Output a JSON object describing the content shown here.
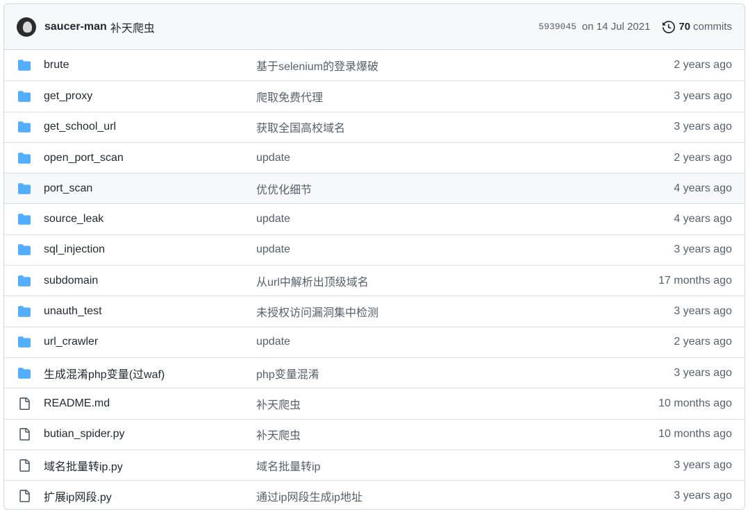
{
  "latest_commit": {
    "author": "saucer-man",
    "message": "补天爬虫",
    "sha": "5939045",
    "date": "on 14 Jul 2021",
    "commits_count": "70",
    "commits_label": "commits"
  },
  "colors": {
    "folder": "#54aeff",
    "file_icon": "#57606a",
    "border": "#d0d7de",
    "header_bg": "#f6f8fa"
  },
  "files": [
    {
      "type": "folder",
      "icon": "folder-icon",
      "name": "brute",
      "message": "基于selenium的登录爆破",
      "age": "2 years ago"
    },
    {
      "type": "folder",
      "icon": "folder-icon",
      "name": "get_proxy",
      "message": "爬取免费代理",
      "age": "3 years ago"
    },
    {
      "type": "folder",
      "icon": "folder-icon",
      "name": "get_school_url",
      "message": "获取全国高校域名",
      "age": "3 years ago"
    },
    {
      "type": "folder",
      "icon": "folder-icon",
      "name": "open_port_scan",
      "message": "update",
      "age": "2 years ago"
    },
    {
      "type": "folder",
      "icon": "folder-icon",
      "name": "port_scan",
      "message": "优优化细节",
      "age": "4 years ago"
    },
    {
      "type": "folder",
      "icon": "folder-icon",
      "name": "source_leak",
      "message": "update",
      "age": "4 years ago"
    },
    {
      "type": "folder",
      "icon": "folder-icon",
      "name": "sql_injection",
      "message": "update",
      "age": "3 years ago"
    },
    {
      "type": "folder",
      "icon": "folder-icon",
      "name": "subdomain",
      "message": "从url中解析出顶级域名",
      "age": "17 months ago"
    },
    {
      "type": "folder",
      "icon": "folder-icon",
      "name": "unauth_test",
      "message": "未授权访问漏洞集中检测",
      "age": "3 years ago"
    },
    {
      "type": "folder",
      "icon": "folder-icon",
      "name": "url_crawler",
      "message": "update",
      "age": "2 years ago"
    },
    {
      "type": "folder",
      "icon": "folder-icon",
      "name": "生成混淆php变量(过waf)",
      "message": "php变量混淆",
      "age": "3 years ago"
    },
    {
      "type": "file",
      "icon": "file-icon",
      "name": "README.md",
      "message": "补天爬虫",
      "age": "10 months ago"
    },
    {
      "type": "file",
      "icon": "file-icon",
      "name": "butian_spider.py",
      "message": "补天爬虫",
      "age": "10 months ago"
    },
    {
      "type": "file",
      "icon": "file-icon",
      "name": "域名批量转ip.py",
      "message": "域名批量转ip",
      "age": "3 years ago"
    },
    {
      "type": "file",
      "icon": "file-icon",
      "name": "扩展ip网段.py",
      "message": "通过ip网段生成ip地址",
      "age": "3 years ago"
    }
  ]
}
